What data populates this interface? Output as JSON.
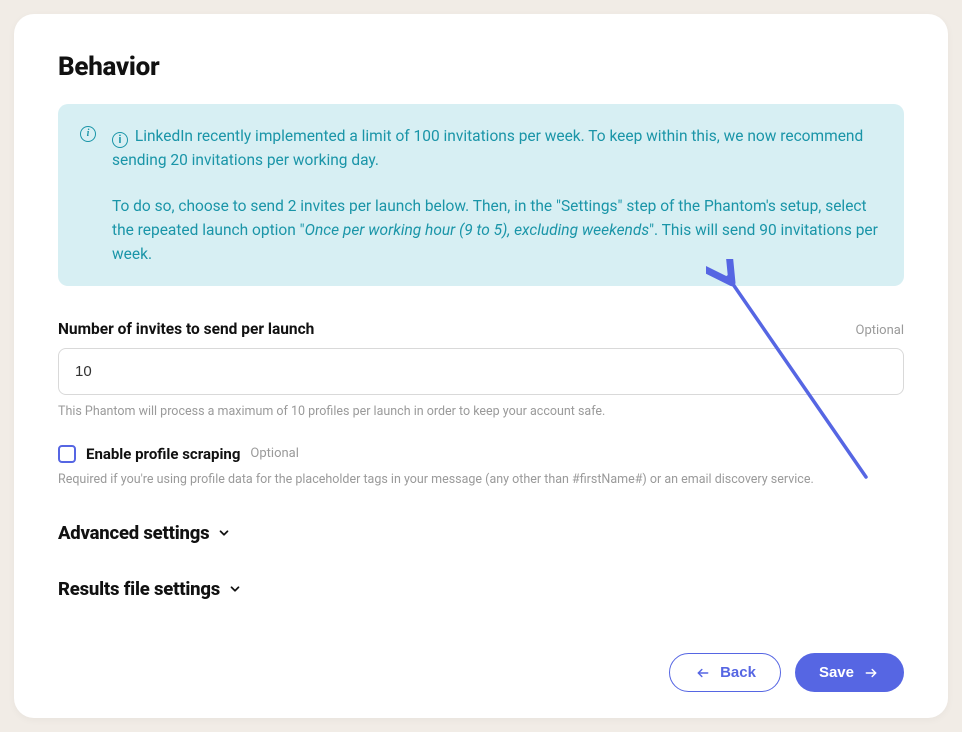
{
  "title": "Behavior",
  "info": {
    "para1": "LinkedIn recently implemented a limit of 100 invitations per week. To keep within this, we now recommend sending 20 invitations per working day.",
    "para2_pre": "To do so, choose to send 2 invites per launch below. Then, in the \"Settings\" step of the Phantom's setup, select the repeated launch option \"",
    "para2_em": "Once per working hour (9 to 5), excluding weekends",
    "para2_post": "\". This will send 90 invitations per week."
  },
  "invites_field": {
    "label": "Number of invites to send per launch",
    "optional": "Optional",
    "value": "10",
    "help": "This Phantom will process a maximum of 10 profiles per launch in order to keep your account safe."
  },
  "scraping": {
    "label": "Enable profile scraping",
    "optional": "Optional",
    "help": "Required if you're using profile data for the placeholder tags in your message (any other than #firstName#) or an email discovery service."
  },
  "collapsibles": {
    "advanced": "Advanced settings",
    "results": "Results file settings"
  },
  "buttons": {
    "back": "Back",
    "save": "Save"
  }
}
